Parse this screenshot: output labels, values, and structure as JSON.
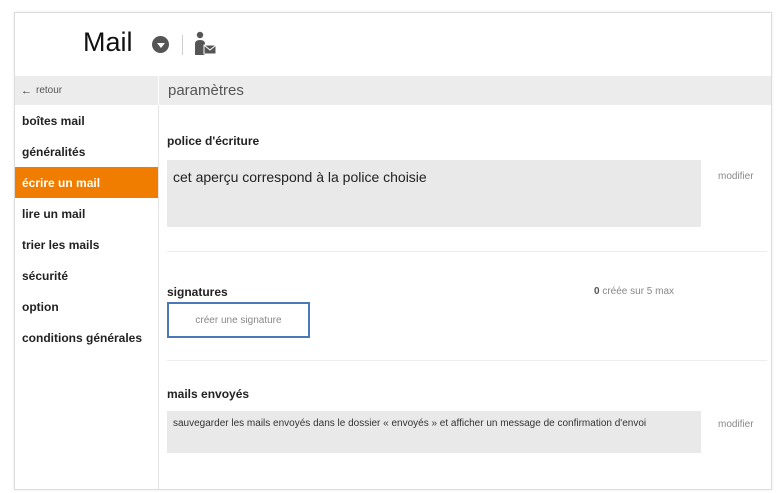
{
  "header": {
    "app_title": "Mail",
    "dropdown_icon": "chevron-down-circle-icon",
    "contact_icon": "person-mail-icon"
  },
  "subbar": {
    "back_label": "retour",
    "back_icon": "arrow-left-icon",
    "section_title": "paramètres"
  },
  "sidebar": {
    "items": [
      {
        "label": "boîtes mail",
        "active": false
      },
      {
        "label": "généralités",
        "active": false
      },
      {
        "label": "écrire un mail",
        "active": true
      },
      {
        "label": "lire un mail",
        "active": false
      },
      {
        "label": "trier les mails",
        "active": false
      },
      {
        "label": "sécurité",
        "active": false
      },
      {
        "label": "option",
        "active": false
      },
      {
        "label": "conditions générales",
        "active": false
      }
    ]
  },
  "font_section": {
    "heading": "police d'écriture",
    "preview_text": "cet aperçu correspond à la police choisie",
    "modify_label": "modifier"
  },
  "signatures_section": {
    "heading": "signatures",
    "count_number": "0",
    "count_text": "créée sur 5 max",
    "create_button_label": "créer une signature"
  },
  "sent_section": {
    "heading": "mails envoyés",
    "description": "sauvegarder les mails envoyés dans le dossier « envoyés » et afficher un message de confirmation d'envoi",
    "modify_label": "modifier"
  },
  "colors": {
    "accent": "#f07d00",
    "button_border": "#4a78b8",
    "panel_bg": "#e9e9e9"
  }
}
